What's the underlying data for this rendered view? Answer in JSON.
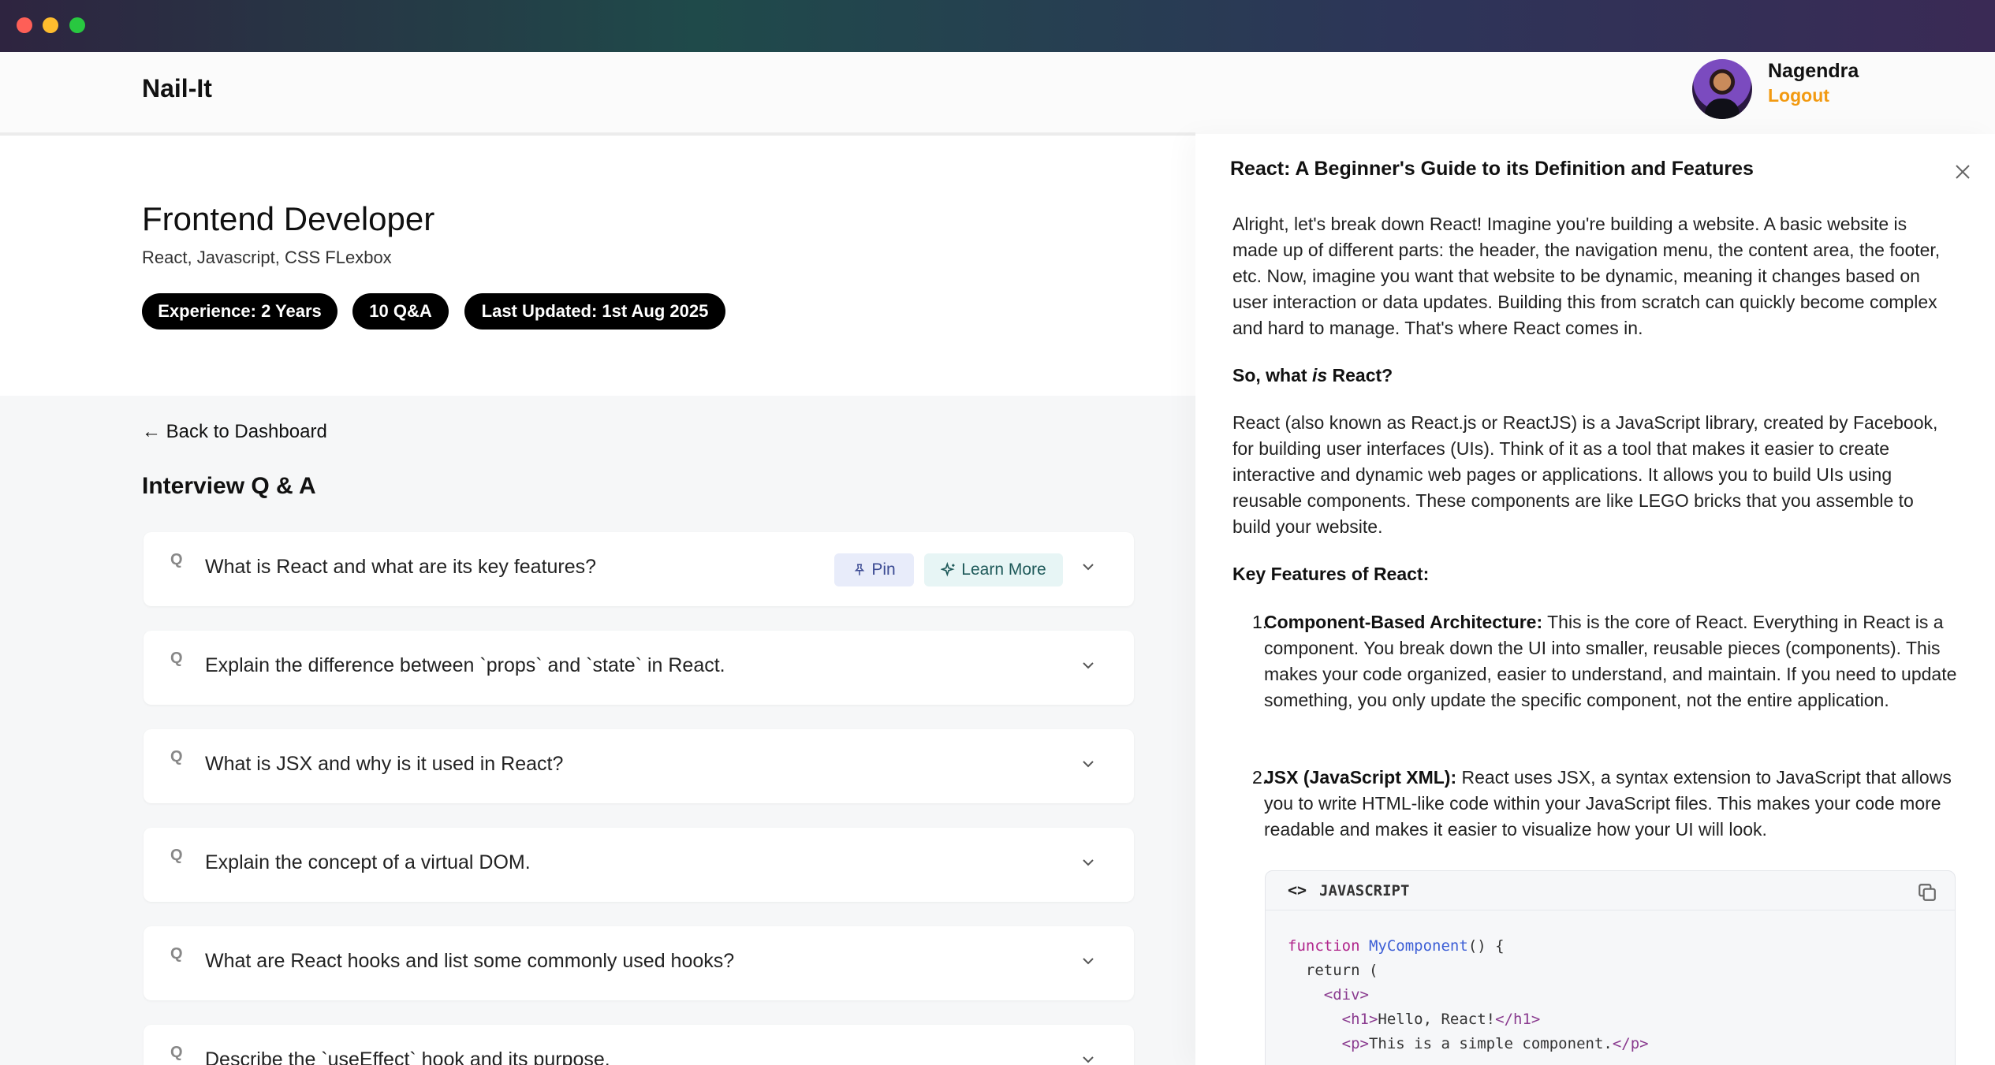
{
  "window": {
    "controls": [
      "close",
      "minimize",
      "maximize"
    ]
  },
  "header": {
    "brand": "Nail-It",
    "user_name": "Nagendra",
    "logout_label": "Logout"
  },
  "hero": {
    "title": "Frontend Developer",
    "skills": "React, Javascript, CSS FLexbox",
    "pills": [
      "Experience: 2 Years",
      "10 Q&A",
      "Last Updated: 1st Aug 2025"
    ]
  },
  "main": {
    "back_label": "← Back to Dashboard",
    "section_title": "Interview Q & A",
    "q_marker": "Q",
    "pin_label": "Pin",
    "learn_more_label": "Learn More",
    "questions": [
      "What is React and what are its key features?",
      "Explain the difference between `props` and `state` in React.",
      "What is JSX and why is it used in React?",
      "Explain the concept of a virtual DOM.",
      "What are React hooks and list some commonly used hooks?",
      "Describe the `useEffect` hook and its purpose."
    ]
  },
  "drawer": {
    "title": "React: A Beginner's Guide to its Definition and Features",
    "intro": "Alright, let's break down React! Imagine you're building a website. A basic website is made up of different parts: the header, the navigation menu, the content area, the footer, etc. Now, imagine you want that website to be dynamic, meaning it changes based on user interaction or data updates. Building this from scratch can quickly become complex and hard to manage. That's where React comes in.",
    "heading_what_pre": "So, what ",
    "heading_what_em": "is",
    "heading_what_post": " React?",
    "definition": "React (also known as React.js or ReactJS) is a JavaScript library, created by Facebook, for building user interfaces (UIs). Think of it as a tool that makes it easier to create interactive and dynamic web pages or applications. It allows you to build UIs using reusable components. These components are like LEGO bricks that you assemble to build your website.",
    "heading_features": "Key Features of React:",
    "features": [
      {
        "num": "1.",
        "title": "Component-Based Architecture:",
        "text": " This is the core of React. Everything in React is a component. You break down the UI into smaller, reusable pieces (components). This makes your code organized, easier to understand, and maintain. If you need to update something, you only update the specific component, not the entire application."
      },
      {
        "num": "2.",
        "title": "JSX (JavaScript XML):",
        "text": " React uses JSX, a syntax extension to JavaScript that allows you to write HTML-like code within your JavaScript files. This makes your code more readable and makes it easier to visualize how your UI will look."
      }
    ],
    "code": {
      "icon": "<>",
      "language": "JAVASCRIPT",
      "line1_kw": "function",
      "line1_fn": "MyComponent",
      "line1_rest": "() {",
      "line2": "  return (",
      "line3": "    <div>",
      "line4_open": "<h1>",
      "line4_text": "Hello, React!",
      "line4_close": "</h1>",
      "line5_open": "<p>",
      "line5_text": "This is a simple component.",
      "line5_close": "</p>"
    }
  }
}
